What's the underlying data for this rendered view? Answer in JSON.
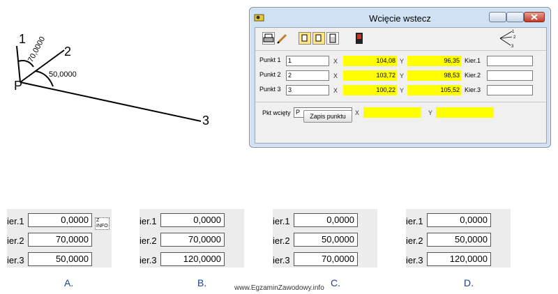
{
  "diagram": {
    "labels": {
      "p": "P",
      "n1": "1",
      "n2": "2",
      "n3": "3"
    },
    "angles": {
      "a1": "70,0000",
      "a2": "50,0000"
    }
  },
  "window": {
    "title": "Wcięcie wstecz",
    "rows": [
      {
        "label": "Punkt 1",
        "point": "1",
        "x_label": "X",
        "x": "104,08",
        "y_label": "Y",
        "y": "96,35",
        "dir_label": "Kier.1",
        "dir": ""
      },
      {
        "label": "Punkt 2",
        "point": "2",
        "x_label": "X",
        "x": "103,72",
        "y_label": "Y",
        "y": "98,53",
        "dir_label": "Kier.2",
        "dir": ""
      },
      {
        "label": "Punkt 3",
        "point": "3",
        "x_label": "X",
        "x": "100,22",
        "y_label": "Y",
        "y": "105,52",
        "dir_label": "Kier.3",
        "dir": ""
      }
    ],
    "target": {
      "label": "Pkt wcięty",
      "point": "P",
      "x_label": "X",
      "x": "",
      "y_label": "Y",
      "y": ""
    },
    "save_label": "Zapis punktu",
    "icon_labels": {
      "l1": "1",
      "l2": "2",
      "l3": "3"
    }
  },
  "options": [
    {
      "letter": "A.",
      "rows": [
        {
          "label": "ier.1",
          "value": "0,0000"
        },
        {
          "label": "ier.2",
          "value": "70,0000"
        },
        {
          "label": "ier.3",
          "value": "50,0000"
        }
      ]
    },
    {
      "letter": "B.",
      "rows": [
        {
          "label": "ier.1",
          "value": "0,0000"
        },
        {
          "label": "ier.2",
          "value": "70,0000"
        },
        {
          "label": "ier.3",
          "value": "120,0000"
        }
      ]
    },
    {
      "letter": "C.",
      "rows": [
        {
          "label": "ier.1",
          "value": "0,0000"
        },
        {
          "label": "ier.2",
          "value": "50,0000"
        },
        {
          "label": "ier.3",
          "value": "70,0000"
        }
      ]
    },
    {
      "letter": "D.",
      "rows": [
        {
          "label": "ier.1",
          "value": "0,0000"
        },
        {
          "label": "ier.2",
          "value": "50,0000"
        },
        {
          "label": "ier.3",
          "value": "120,0000"
        }
      ]
    }
  ],
  "info_icon": {
    "line1": "Z",
    "line2": "INFO"
  },
  "watermark": "www.EgzaminZawodowy.info"
}
